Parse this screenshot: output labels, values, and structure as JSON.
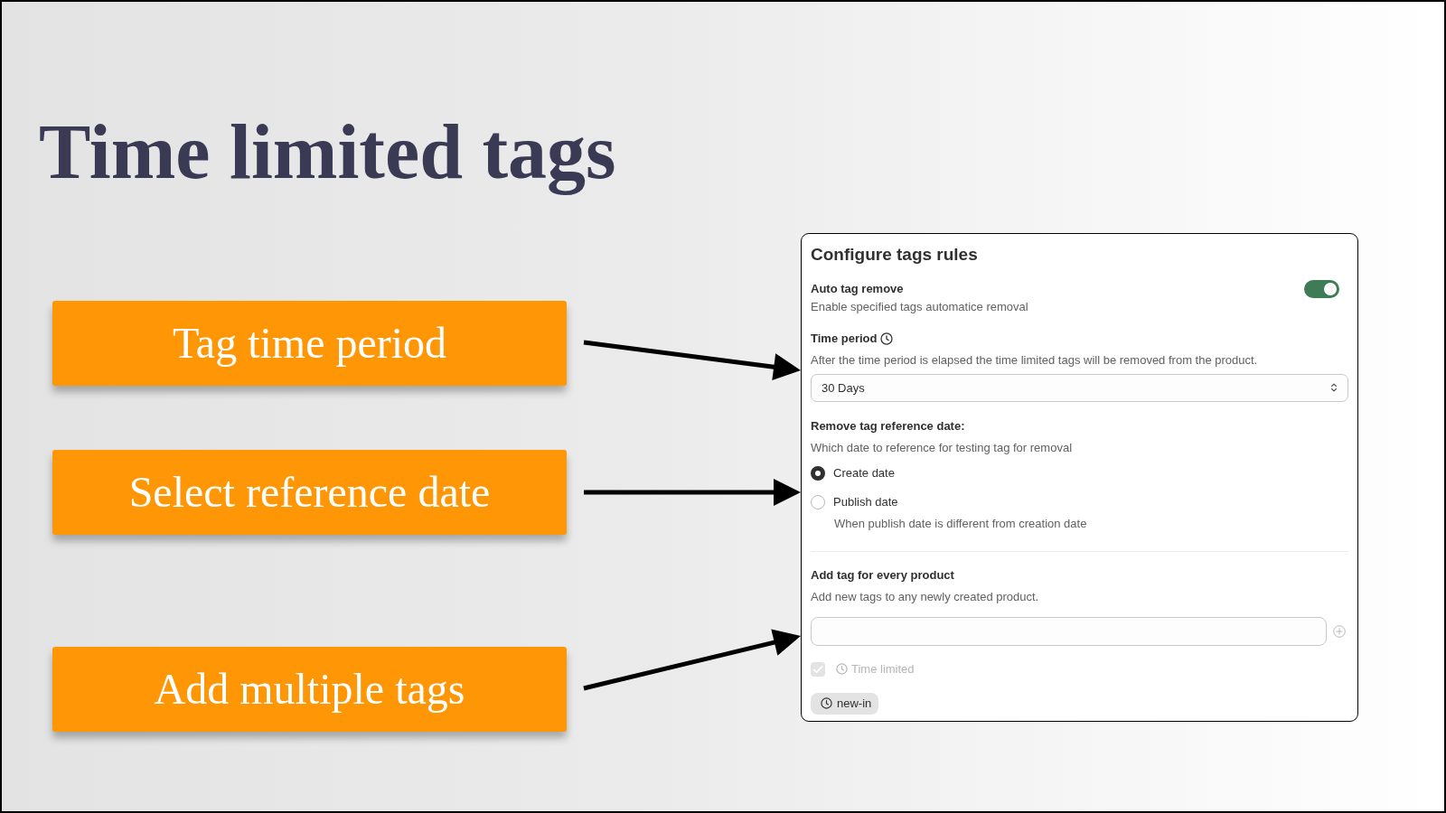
{
  "slide": {
    "title": "Time limited tags"
  },
  "callouts": [
    {
      "label": "Tag time period"
    },
    {
      "label": "Select reference date"
    },
    {
      "label": "Add multiple tags"
    }
  ],
  "panel": {
    "title": "Configure tags rules",
    "auto_remove": {
      "label": "Auto tag remove",
      "description": "Enable specified tags automatice removal",
      "on": true
    },
    "time_period": {
      "label": "Time period",
      "description": "After the time period is elapsed the time limited tags will be removed from the product.",
      "select": {
        "value": "30 Days"
      }
    },
    "reference_date": {
      "label": "Remove tag reference date:",
      "description": "Which date to reference for testing tag for removal",
      "options": [
        {
          "label": "Create date",
          "selected": true
        },
        {
          "label": "Publish date",
          "selected": false,
          "description": "When publish date is different from creation date"
        }
      ]
    },
    "add_tag": {
      "label": "Add tag for every product",
      "description": "Add new tags to any newly created product.",
      "time_limited": {
        "label": "Time limited",
        "checked": true,
        "disabled": true
      },
      "tags": [
        {
          "label": "new-in"
        }
      ]
    }
  }
}
